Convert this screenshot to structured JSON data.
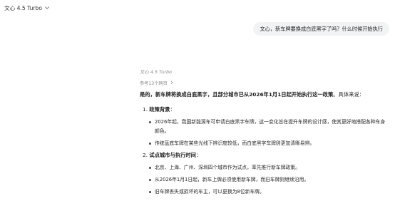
{
  "header": {
    "model_label": "文心 4.5 Turbo"
  },
  "conversation": {
    "user_message": "文心，新车牌要换成白底黑字了吗？什么时候开始执行",
    "answer": {
      "model_label": "文心 4.5 Turbo",
      "references_label": "参考13个网页",
      "lead_bold": "是的，新车牌将换成白底黑字，且部分城市已从2026年1月1日起开始执行这一政策",
      "lead_rest": "。具体来说：",
      "sections": [
        {
          "number": "1.",
          "title": "政策背景",
          "colon": "：",
          "bullets": [
            "2026年起，我国新能源车可申请白底黑字车牌，这一变化旨在提升车牌的设计感，使其更好地搭配各种车身颜色。",
            "传统蓝底车牌在某些光线下辨识度较低，而白底黑字车牌则更加清晰易辨。"
          ]
        },
        {
          "number": "2.",
          "title": "试点城市与执行时间",
          "colon": "：",
          "bullets": [
            "北京、上海、广州、深圳四个城市作为试点，率先推行新车牌政策。",
            "从2026年1月1日起，新车上牌必须使用新车牌，而旧车牌则继续沿用。",
            "旧车牌丢失或损坏的车主，可以更换为8位新车牌。"
          ]
        }
      ]
    }
  }
}
